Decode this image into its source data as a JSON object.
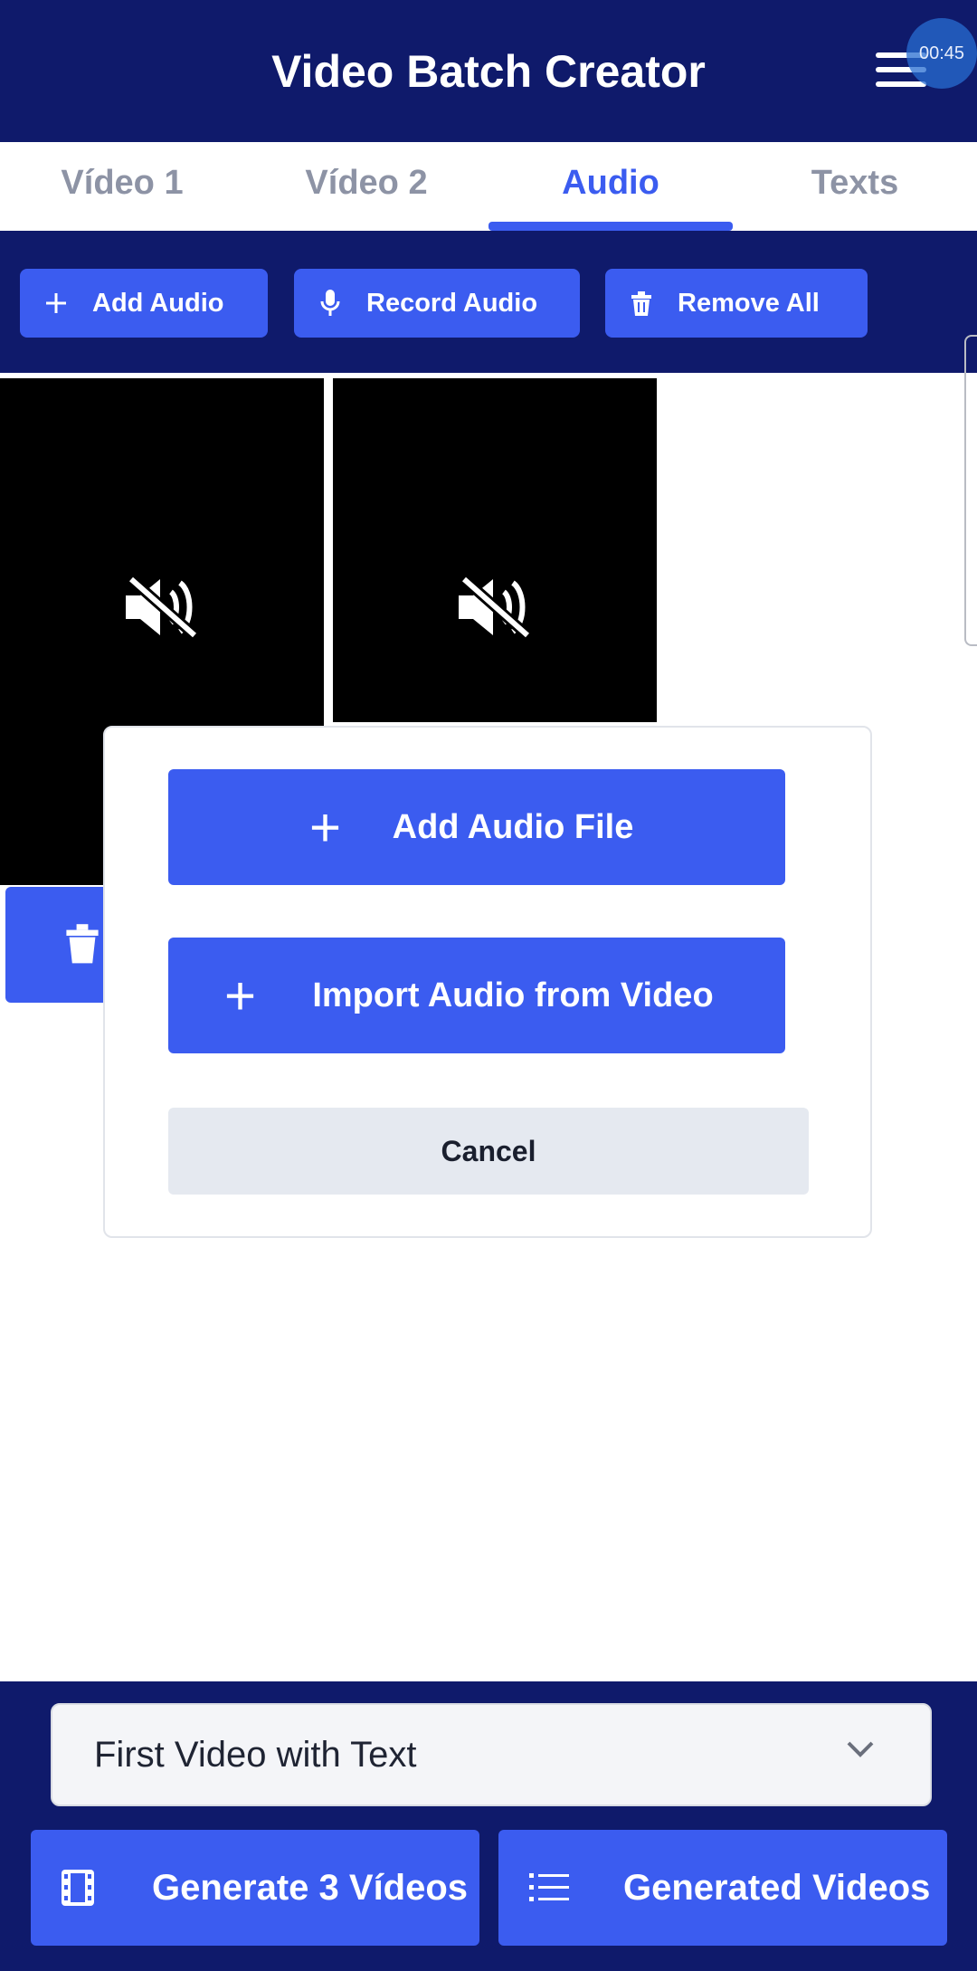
{
  "app": {
    "title": "Video Batch Creator",
    "recording_timer": "00:45"
  },
  "tabs": [
    {
      "label": "Vídeo 1"
    },
    {
      "label": "Vídeo 2"
    },
    {
      "label": "Audio",
      "active": true
    },
    {
      "label": "Texts"
    }
  ],
  "toolbar": {
    "add_audio": "Add Audio",
    "record_audio": "Record Audio",
    "remove_all": "Remove All"
  },
  "media": {
    "items": [
      {
        "icon": "muted-speaker-icon"
      },
      {
        "icon": "muted-speaker-icon"
      }
    ]
  },
  "dialog": {
    "add_audio_file": "Add Audio File",
    "import_audio_from_video": "Import Audio from Video",
    "cancel": "Cancel"
  },
  "bottom": {
    "select_value": "First Video with Text",
    "generate": "Generate 3 Vídeos",
    "generated": "Generated Videos"
  },
  "colors": {
    "primary": "#3b5cf0",
    "navy": "#0f1a6b",
    "muted_tab": "#8d93a5"
  }
}
